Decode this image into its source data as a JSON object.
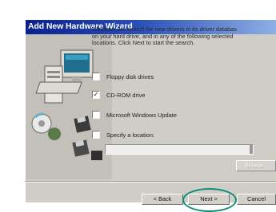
{
  "window": {
    "title": "Add New Hardware Wizard"
  },
  "description": {
    "line1": "Windows will search for new drivers in its driver databas",
    "line2": "on your hard drive, and in any of the following selected",
    "line3": "locations. Click Next to start the search."
  },
  "options": [
    {
      "label": "Floppy disk drives",
      "checked": false
    },
    {
      "label": "CD-ROM drive",
      "checked": true,
      "mark": "✓"
    },
    {
      "label": "Microsoft Windows Update",
      "checked": false
    },
    {
      "label": "Specify a location:",
      "checked": false
    }
  ],
  "location": {
    "value": ""
  },
  "buttons": {
    "browse": "Browse...",
    "back": "< Back",
    "next": "Next >",
    "cancel": "Cancel"
  },
  "colors": {
    "titlebar_start": "#0b1f8c",
    "titlebar_end": "#8fb0e4",
    "highlight_circle": "#0f8f7a"
  },
  "icons": [
    "computer-icon",
    "cd-disc-icon",
    "floppy-disk-icon"
  ]
}
